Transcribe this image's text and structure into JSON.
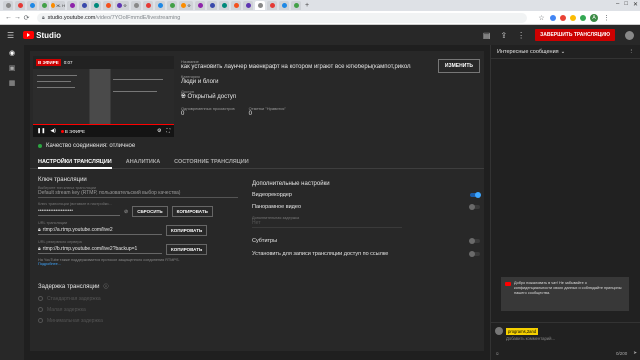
{
  "browser": {
    "url_host": "studio.youtube.com",
    "url_path": "/video/7YOoIFmmdE/livestreaming",
    "tabs": [
      "",
      "",
      "",
      "",
      "Ж. Н",
      "",
      "",
      "",
      "",
      "Ф",
      "",
      "",
      "",
      "",
      "Ф",
      "",
      "",
      "",
      "",
      "",
      "",
      "",
      "",
      ""
    ]
  },
  "header": {
    "logo_text": "Studio",
    "end_stream_label": "ЗАВЕРШИТЬ ТРАНСЛЯЦИЮ"
  },
  "preview": {
    "live_badge": "В ЭФИРЕ",
    "time": "0:07",
    "live_label": "В ЭФИРЕ"
  },
  "info": {
    "title_label": "Название",
    "title": "как установить лаунчер маенкрафт на котором играют все ютюберы(кампот,рикола...",
    "category_label": "Категория",
    "category": "Люди и блоги",
    "privacy_label": "Доступ",
    "privacy": "Открытый доступ",
    "viewers_label": "Одновременных просмотров",
    "viewers": "0",
    "likes_label": "Отметки \"Нравится\"",
    "likes": "0",
    "change_label": "ИЗМЕНИТЬ"
  },
  "quality": "Качество соединения: отличное",
  "tabs": [
    "НАСТРОЙКИ ТРАНСЛЯЦИИ",
    "АНАЛИТИКА",
    "СОСТОЯНИЕ ТРАНСЛЯЦИИ"
  ],
  "stream_key": {
    "section_title": "Ключ трансляции",
    "select_label": "Выберите тип ключа трансляции",
    "select_value": "Default stream key (RTMP, пользовательский выбор качества)",
    "key_label": "Ключ трансляции (вставьте в настройки...",
    "key_value": "••••••••••••••••••••",
    "reset_label": "СБРОСИТЬ",
    "copy_label": "КОПИРОВАТЬ",
    "url_label": "URL трансляции",
    "url_value": "rtmp://a.rtmp.youtube.com/live2",
    "copy2_label": "КОПИРОВАТЬ",
    "backup_label": "URL резервного сервера",
    "backup_value": "rtmp://b.rtmp.youtube.com/live2?backup=1",
    "copy3_label": "КОПИРОВАТЬ",
    "note": "На YouTube также поддерживается протокол защищенного соединения RTMPS.",
    "note_link": "Подробнее..."
  },
  "latency": {
    "title": "Задержка трансляции",
    "options": [
      "Стандартная задержка",
      "Малая задержка",
      "Минимальная задержка"
    ]
  },
  "extra": {
    "title": "Дополнительные настройки",
    "dvr": "Видеорекордер",
    "dvr_on": true,
    "pano": "Панорамное видео",
    "delay_label": "Дополнительная задержка",
    "delay_value": "Нет",
    "subs": "Субтитры",
    "unlisted": "Установить для записи трансляции доступ по ссылке"
  },
  "chat": {
    "header": "Интересные сообщения",
    "toast": "Добро пожаловать в чат! Не забывайте о конфиденциальности своих данных и соблюдайте принципы нашего сообщества.",
    "username": "programs,2and",
    "placeholder": "Добавить комментарий...",
    "counter": "0/200"
  }
}
